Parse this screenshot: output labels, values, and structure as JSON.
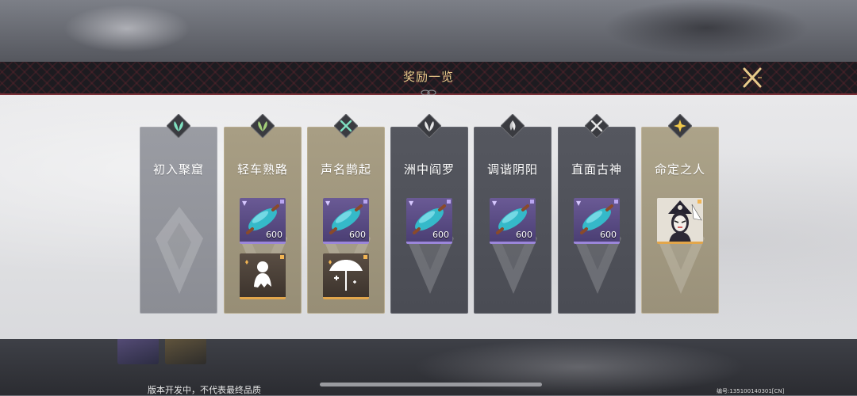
{
  "header": {
    "title": "奖励一览"
  },
  "cards": [
    {
      "title": "初入聚窟",
      "style": "grey",
      "badge_color": "#7fe0c0",
      "badge_icon": "leaf-icon",
      "items": []
    },
    {
      "title": "轻车熟路",
      "style": "gold",
      "badge_color": "#a3d07a",
      "badge_icon": "leaf-icon",
      "items": [
        {
          "kind": "cyan-cocoon",
          "icon": "cocoon-icon",
          "rarity": "purple",
          "qty": "600"
        },
        {
          "kind": "ghost-figure",
          "icon": "ghost-figure-icon",
          "rarity": "orange",
          "qty": ""
        }
      ]
    },
    {
      "title": "声名鹊起",
      "style": "gold",
      "badge_color": "#7fe0c0",
      "badge_icon": "crossed-blades-icon",
      "items": [
        {
          "kind": "cyan-cocoon",
          "icon": "cocoon-icon",
          "rarity": "purple",
          "qty": "600"
        },
        {
          "kind": "umbrella",
          "icon": "umbrella-icon",
          "rarity": "orange",
          "qty": ""
        }
      ]
    },
    {
      "title": "洲中阎罗",
      "style": "dark",
      "badge_color": "#e6e6e6",
      "badge_icon": "leaf-icon",
      "items": [
        {
          "kind": "cyan-cocoon",
          "icon": "cocoon-icon",
          "rarity": "purple",
          "qty": "600"
        }
      ]
    },
    {
      "title": "调谐阴阳",
      "style": "dark",
      "badge_color": "#e6e6e6",
      "badge_icon": "flame-icon",
      "items": [
        {
          "kind": "cyan-cocoon",
          "icon": "cocoon-icon",
          "rarity": "purple",
          "qty": "600"
        }
      ]
    },
    {
      "title": "直面古神",
      "style": "dark",
      "badge_color": "#e6e6e6",
      "badge_icon": "crossed-blades-icon",
      "items": [
        {
          "kind": "cyan-cocoon",
          "icon": "cocoon-icon",
          "rarity": "purple",
          "qty": "600"
        }
      ]
    },
    {
      "title": "命定之人",
      "style": "gold2",
      "badge_color": "#f0c84a",
      "badge_icon": "star-burst-icon",
      "items": [
        {
          "kind": "portrait",
          "icon": "masked-portrait-icon",
          "rarity": "orange-light",
          "qty": ""
        }
      ]
    }
  ],
  "footer": {
    "note": "版本开发中，不代表最终品质",
    "build_id": "编号:135100140301[CN]"
  }
}
